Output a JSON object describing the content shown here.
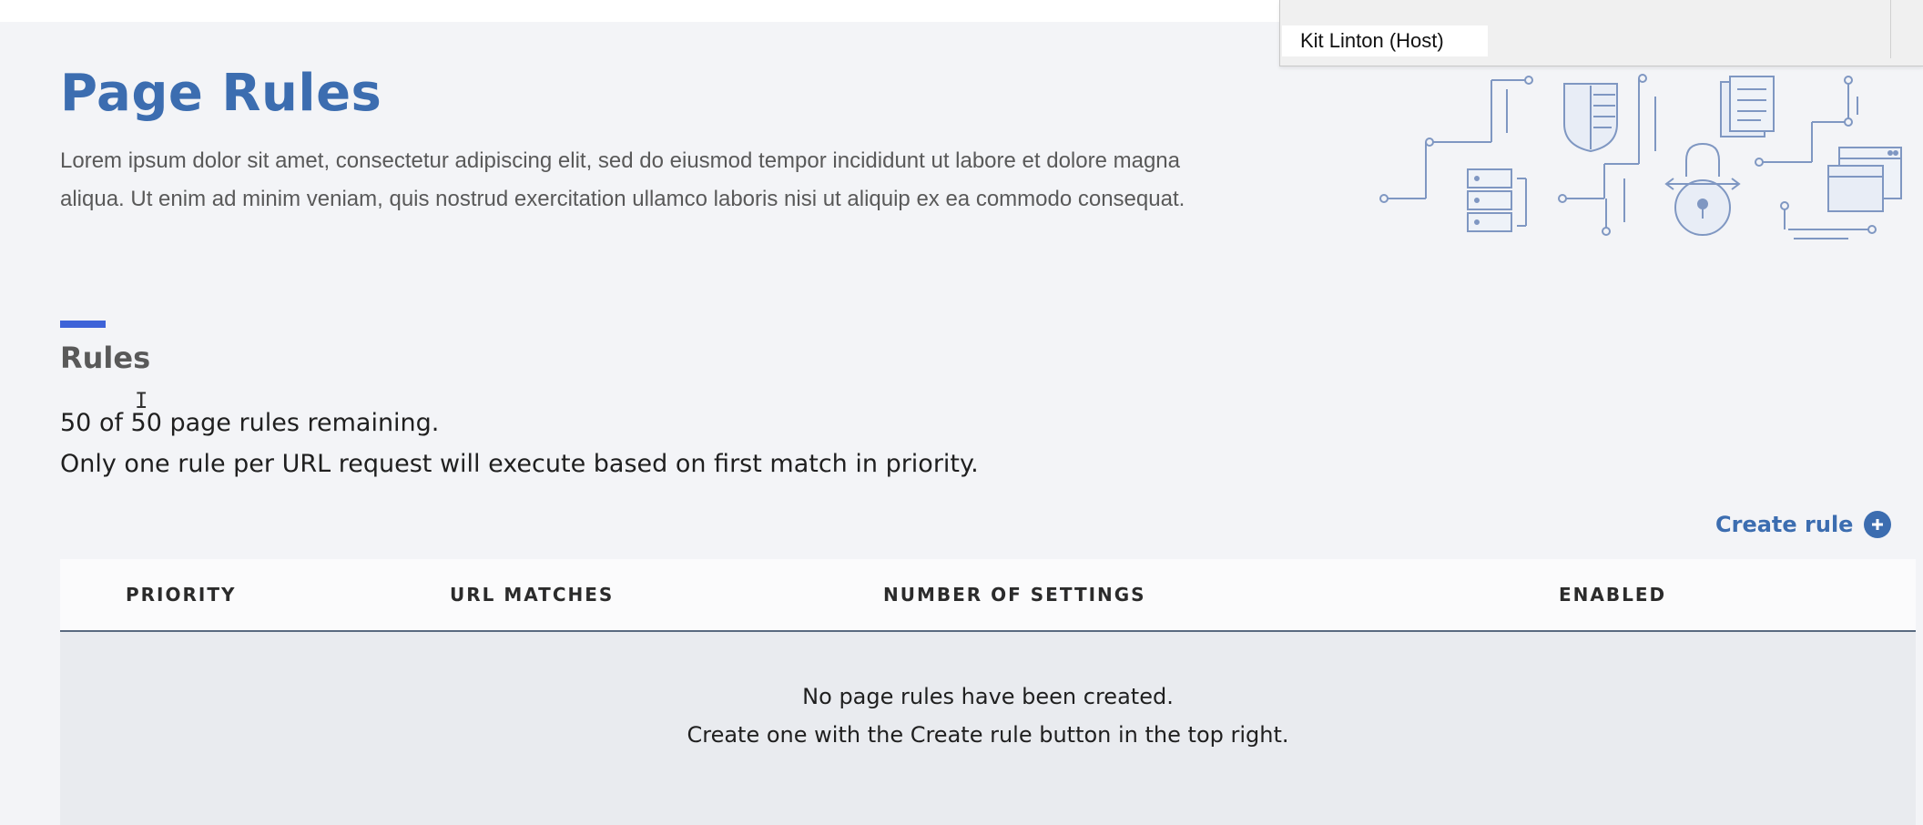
{
  "host_panel": {
    "label": "Kit Linton (Host)"
  },
  "header": {
    "title": "Page Rules",
    "description": "Lorem ipsum dolor sit amet, consectetur adipiscing elit, sed do eiusmod tempor incididunt ut labore et dolore magna aliqua. Ut enim ad minim veniam, quis nostrud exercitation ullamco laboris nisi ut aliquip ex ea commodo consequat."
  },
  "rules_section": {
    "title": "Rules",
    "remaining_text": "50 of 50 page rules remaining.",
    "priority_note": "Only one rule per URL request will execute based on first match in priority.",
    "create_rule_label": "Create rule",
    "create_rule_icon": "plus-circle-icon"
  },
  "table": {
    "columns": [
      "PRIORITY",
      "URL MATCHES",
      "NUMBER OF SETTINGS",
      "ENABLED"
    ],
    "empty_line_1": "No page rules have been created.",
    "empty_line_2": "Create one with the Create rule button in the top right."
  },
  "colors": {
    "accent": "#3c6db0",
    "section_bar": "#3e63d8",
    "background": "#f3f4f7"
  }
}
